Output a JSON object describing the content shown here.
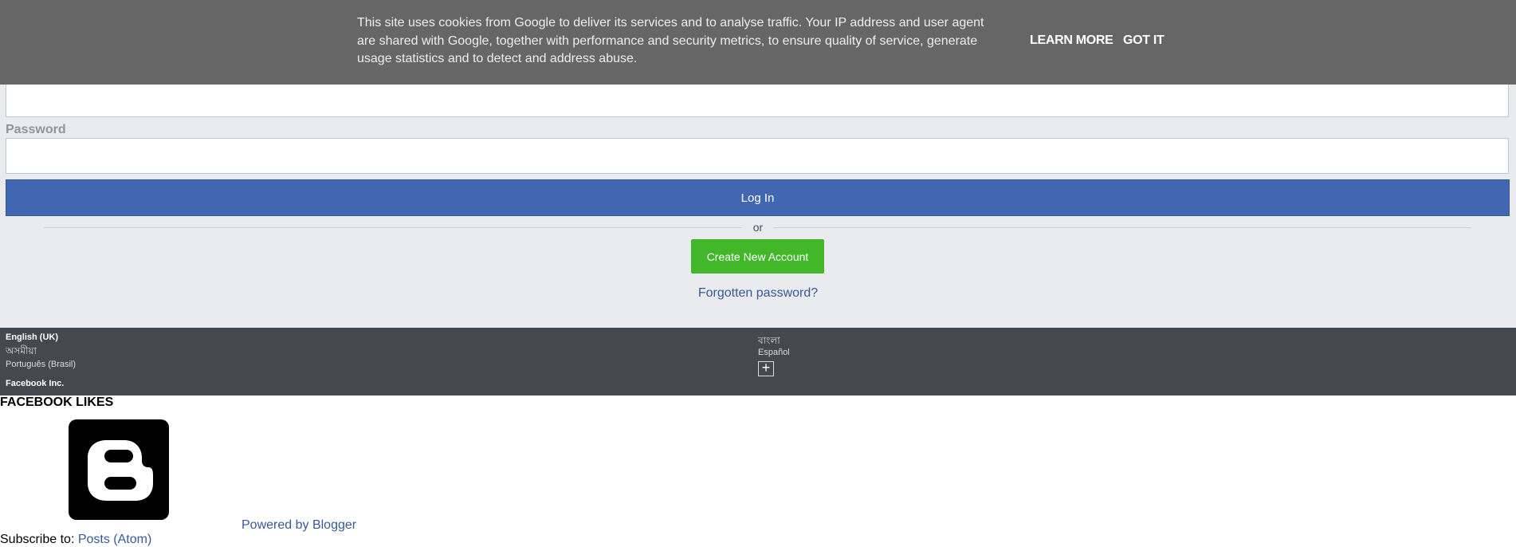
{
  "cookie": {
    "text": "This site uses cookies from Google to deliver its services and to analyse traffic. Your IP address and user agent are shared with Google, together with performance and security metrics, to ensure quality of service, generate usage statistics and to detect and address abuse.",
    "learn_more": "LEARN MORE",
    "got_it": "GOT IT"
  },
  "login": {
    "password_label": "Password",
    "email_value": "",
    "password_value": "",
    "login_button": "Log In",
    "or_text": "or",
    "create_button": "Create New Account",
    "forgot_link": "Forgotten password?"
  },
  "footer": {
    "languages_left": [
      "English (UK)",
      "অসমীয়া",
      "Português (Brasil)"
    ],
    "languages_right": [
      "বাংলা",
      "Español"
    ],
    "more_languages": "+",
    "company": "Facebook Inc."
  },
  "widget": {
    "title": "FACEBOOK LIKES",
    "powered_by": "Powered by Blogger"
  },
  "subscribe": {
    "label": "Subscribe to:",
    "link": "Posts (Atom)"
  },
  "colors": {
    "cookie_bg": "#666666",
    "login_bg": "#e9ebee",
    "login_button": "#4267b2",
    "create_button": "#42b72a",
    "footer_bg": "#444950",
    "link": "#385898"
  }
}
